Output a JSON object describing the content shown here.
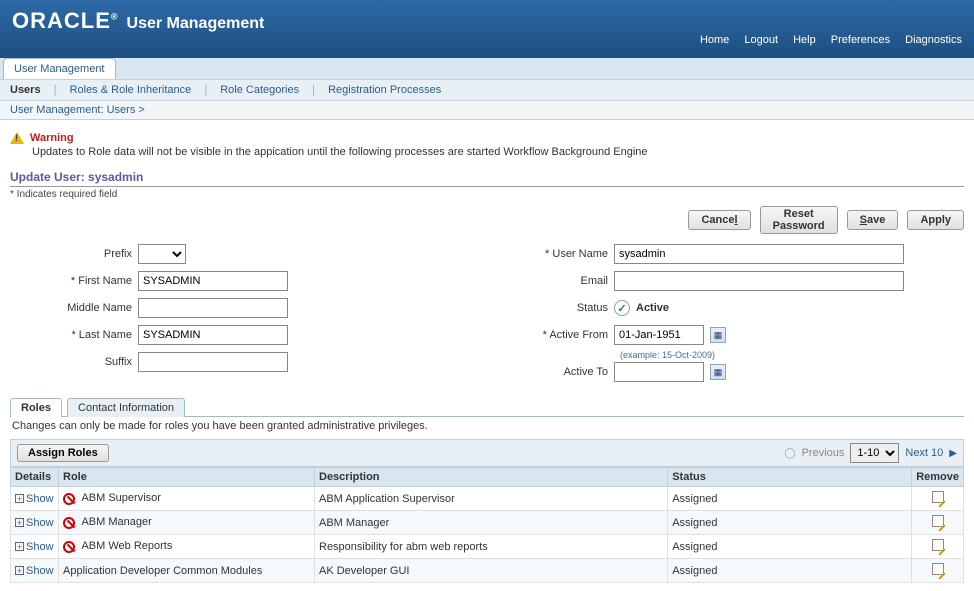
{
  "header": {
    "brand": "ORACLE",
    "title": "User Management",
    "links": {
      "home": "Home",
      "logout": "Logout",
      "help": "Help",
      "preferences": "Preferences",
      "diagnostics": "Diagnostics"
    }
  },
  "tab": {
    "label": "User Management"
  },
  "subnav": {
    "users": "Users",
    "roles_inherit": "Roles & Role Inheritance",
    "role_cat": "Role Categories",
    "reg_proc": "Registration Processes"
  },
  "breadcrumb": "User Management: Users  >",
  "warning": {
    "title": "Warning",
    "message": "Updates to Role data will not be visible in the appication until the following processes are started Workflow Background Engine"
  },
  "section": {
    "title": "Update User: sysadmin",
    "req_note": "* Indicates required field"
  },
  "buttons": {
    "cancel": "Cancel",
    "reset_pw_l1": "Reset",
    "reset_pw_l2": "Password",
    "save": "Save",
    "apply": "Apply"
  },
  "form": {
    "labels": {
      "prefix": "Prefix",
      "first": "First Name",
      "middle": "Middle Name",
      "last": "Last Name",
      "suffix": "Suffix",
      "uname": "User Name",
      "email": "Email",
      "status": "Status",
      "afrom": "Active From",
      "ato": "Active To"
    },
    "values": {
      "prefix": "",
      "first": "SYSADMIN",
      "middle": "",
      "last": "SYSADMIN",
      "suffix": "",
      "uname": "sysadmin",
      "email": "",
      "status": "Active",
      "afrom": "01-Jan-1951",
      "ato": ""
    },
    "hint": "(example: 15-Oct-2009)"
  },
  "subtabs": {
    "roles": "Roles",
    "contact": "Contact Information"
  },
  "subnote": "Changes can only be made for roles you have been granted administrative privileges.",
  "toolbar": {
    "assign": "Assign Roles",
    "prev": "Previous",
    "range": "1-10",
    "next": "Next 10"
  },
  "table": {
    "headers": {
      "details": "Details",
      "role": "Role",
      "desc": "Description",
      "status": "Status",
      "remove": "Remove"
    },
    "show": "Show",
    "rows": [
      {
        "blocked": true,
        "role": "ABM Supervisor",
        "desc": "ABM Application Supervisor",
        "status": "Assigned"
      },
      {
        "blocked": true,
        "role": "ABM Manager",
        "desc": "ABM Manager",
        "status": "Assigned"
      },
      {
        "blocked": true,
        "role": "ABM Web Reports",
        "desc": "Responsibility for abm web reports",
        "status": "Assigned"
      },
      {
        "blocked": false,
        "role": "Application Developer Common Modules",
        "desc": "AK Developer GUI",
        "status": "Assigned"
      }
    ]
  }
}
